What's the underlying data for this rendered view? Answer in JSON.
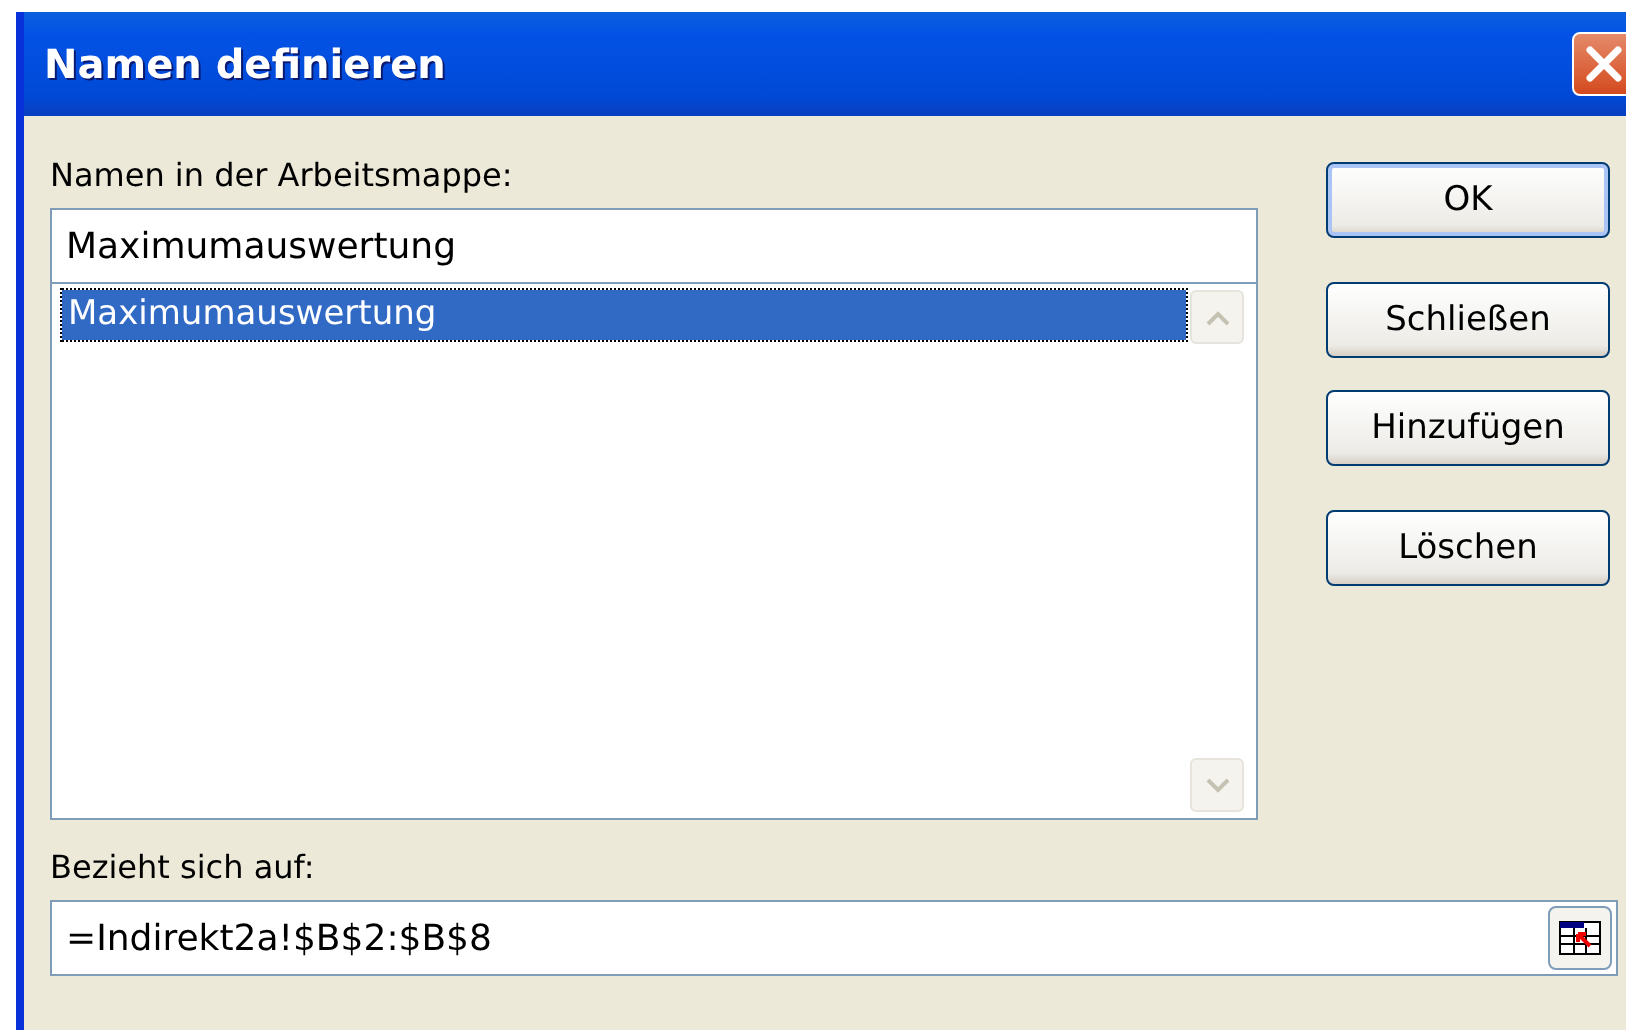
{
  "window": {
    "title": "Namen definieren"
  },
  "names": {
    "label": "Namen in der Arbeitsmappe:",
    "value": "Maximumauswertung",
    "items": [
      {
        "label": "Maximumauswertung",
        "selected": true
      }
    ]
  },
  "buttons": [
    {
      "label": "OK",
      "default": true
    },
    {
      "label": "Schließen",
      "default": false
    },
    {
      "label": "Hinzufügen",
      "default": false
    },
    {
      "label": "Löschen",
      "default": false
    }
  ],
  "refers_to": {
    "label": "Bezieht sich auf:",
    "value": "=Indirekt2a!$B$2:$B$8"
  }
}
